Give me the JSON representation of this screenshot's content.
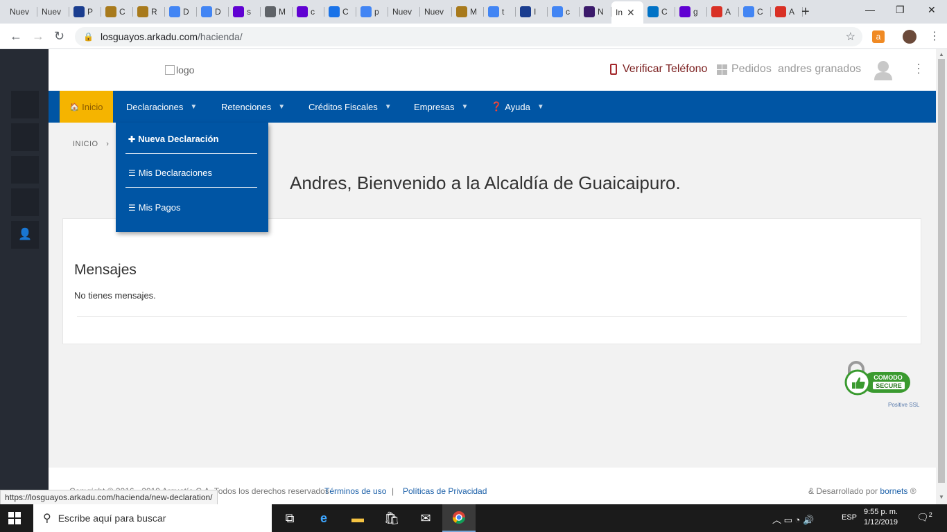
{
  "browser": {
    "tabs": [
      {
        "label": "Nuev",
        "color": "#dee1e6"
      },
      {
        "label": "Nuev",
        "color": "#dee1e6"
      },
      {
        "label": "P",
        "color": "#1a3d8f"
      },
      {
        "label": "C",
        "color": "#a87a1c"
      },
      {
        "label": "R",
        "color": "#a87a1c"
      },
      {
        "label": "D",
        "color": "#4285f4"
      },
      {
        "label": "D",
        "color": "#4285f4"
      },
      {
        "label": "s",
        "color": "#6001d2"
      },
      {
        "label": "M",
        "color": "#5f6368"
      },
      {
        "label": "c",
        "color": "#6001d2"
      },
      {
        "label": "C",
        "color": "#1a73e8"
      },
      {
        "label": "p",
        "color": "#4285f4"
      },
      {
        "label": "Nuev",
        "color": "#dee1e6"
      },
      {
        "label": "Nuev",
        "color": "#dee1e6"
      },
      {
        "label": "M",
        "color": "#a87a1c"
      },
      {
        "label": "t",
        "color": "#4285f4"
      },
      {
        "label": "I",
        "color": "#1a3d8f"
      },
      {
        "label": "c",
        "color": "#4285f4"
      },
      {
        "label": "N",
        "color": "#3b1a6b"
      },
      {
        "label": "In",
        "color": "#ffffff",
        "active": true
      },
      {
        "label": "C",
        "color": "#0072c6"
      },
      {
        "label": "g",
        "color": "#6001d2"
      },
      {
        "label": "A",
        "color": "#d93025"
      },
      {
        "label": "C",
        "color": "#4285f4"
      },
      {
        "label": "A",
        "color": "#d93025"
      }
    ],
    "close_glyph": "✕",
    "new_tab_glyph": "+",
    "url_host": "losguayos.arkadu.com",
    "url_path": "/hacienda/",
    "status_url": "https://losguayos.arkadu.com/hacienda/new-declaration/"
  },
  "header": {
    "logo_alt": "logo",
    "verify_phone": "Verificar Teléfono",
    "orders": "Pedidos",
    "user_name": "andres granados"
  },
  "nav": {
    "home": "Inicio",
    "items": [
      "Declaraciones",
      "Retenciones",
      "Créditos Fiscales",
      "Empresas",
      "Ayuda"
    ]
  },
  "dropdown": {
    "new_declaration": "Nueva Declaración",
    "my_declarations": "Mis Declaraciones",
    "my_payments": "Mis Pagos"
  },
  "breadcrumb": {
    "root": "INICIO",
    "sep": "›"
  },
  "welcome": "Andres, Bienvenido a la Alcaldía de Guaicaipuro.",
  "messages": {
    "title": "Mensajes",
    "empty": "No tienes mensajes."
  },
  "badge": {
    "label": "Positive SSL",
    "top": "COMODO",
    "bottom": "SECURE"
  },
  "footer": {
    "copyright": "Copyright © 2016 - 2019 Arquetío C.A. Todos los derechos reservados",
    "terms": "Términos de uso",
    "separator": "|",
    "privacy": "Políticas de Privacidad",
    "developed_prefix": "& Desarrollado por",
    "developer": "bornets",
    "developer_mark": "®"
  },
  "taskbar": {
    "search_placeholder": "Escribe aquí para buscar",
    "language": "ESP",
    "time": "9:55 p. m.",
    "date": "1/12/2019",
    "notifications": "2"
  },
  "colors": {
    "nav_blue": "#0055a4",
    "home_yellow": "#f5b400",
    "rail_dark": "#262b34"
  }
}
